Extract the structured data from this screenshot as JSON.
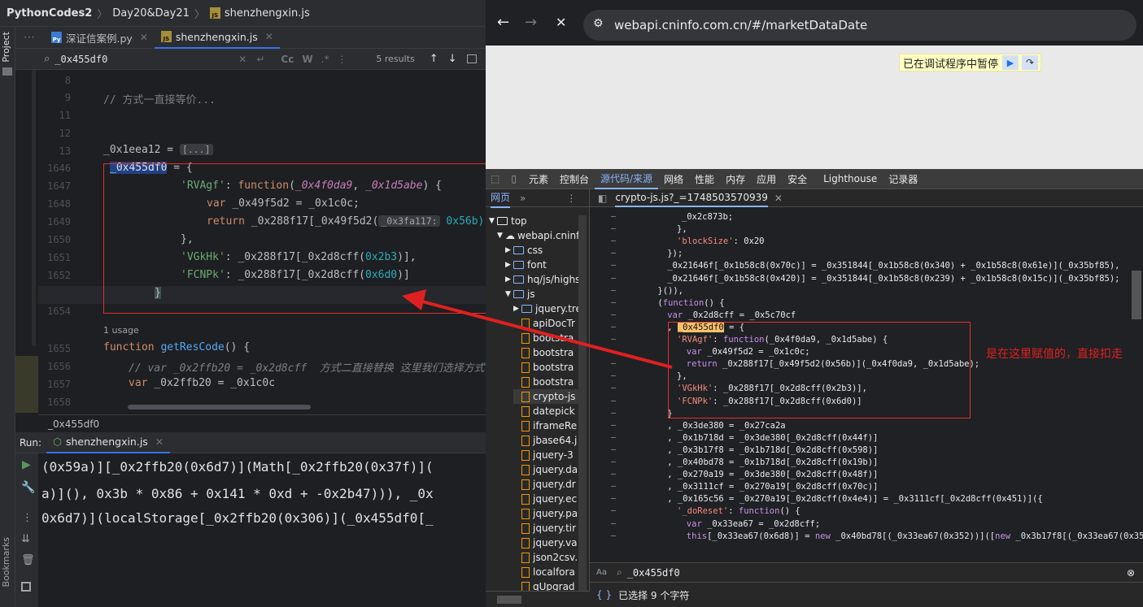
{
  "ide": {
    "breadcrumb": [
      "PythonCodes2",
      "Day20&Day21",
      "shenzhengxin.js"
    ],
    "side_tabs": {
      "project": "Project",
      "bookmarks": "Bookmarks"
    },
    "tabs": [
      {
        "label": "深证信案例.py",
        "active": false
      },
      {
        "label": "shenzhengxin.js",
        "active": true
      }
    ],
    "find": {
      "query": "_0x455df0",
      "results": "5 results",
      "cc": "Cc",
      "w": "W",
      "regex": ".*"
    },
    "lines": [
      {
        "n": "8"
      },
      {
        "n": "9"
      },
      {
        "n": "11"
      },
      {
        "n": "12"
      },
      {
        "n": "13"
      },
      {
        "n": "1646"
      },
      {
        "n": "1647"
      },
      {
        "n": "1648"
      },
      {
        "n": "1649"
      },
      {
        "n": "1650"
      },
      {
        "n": "1651"
      },
      {
        "n": "1652"
      },
      {
        "n": "1653"
      },
      {
        "n": "1654"
      },
      {
        "n": ""
      },
      {
        "n": "1655"
      },
      {
        "n": "1656"
      },
      {
        "n": "1657"
      },
      {
        "n": "1658"
      }
    ],
    "code": {
      "l9": "// 方式一直接等价...",
      "l13_var": "_0x1eea12",
      "l13_fold": "[...]",
      "l1646_var": "_0x455df0",
      "l1647_key": "'RVAgf'",
      "l1647_fn": "function",
      "l1647_p1": "_0x4f0da9",
      "l1647_p2": "_0x1d5abe",
      "l1648_kw": "var",
      "l1648_rest": "_0x49f5d2 = _0x1c0c;",
      "l1649_kw": "return",
      "l1649_rest": "_0x288f17[_0x49f5d2(",
      "l1649_hint": "_0x3fa117:",
      "l1649_num": "0x56b)",
      "l1651_key": "'VGkHk'",
      "l1651_rest": "_0x288f17[_0x2d8cff(",
      "l1651_num": "0x2b3",
      "l1652_key": "'FCNPk'",
      "l1652_rest": "_0x288f17[_0x2d8cff(",
      "l1652_num": "0x6d0",
      "usage": "1 usage",
      "l1655_kw": "function",
      "l1655_fn": "getResCode",
      "l1656_cmt": "// var _0x2ffb20 = _0x2d8cff  方式二直接替换 这里我们选择方式",
      "l1657_kw": "var",
      "l1657_rest": "_0x2ffb20 = _0x1c0c"
    },
    "status_var": "_0x455df0",
    "run": {
      "label": "Run:",
      "tab": "shenzhengxin.js"
    },
    "console": [
      "(0x59a)][_0x2ffb20(0x6d7)](Math[_0x2ffb20(0x37f)](",
      "a)](), 0x3b * 0x86 + 0x141 * 0xd + -0x2b47))), _0x",
      "0x6d7)](localStorage[_0x2ffb20(0x306)](_0x455df0[_"
    ]
  },
  "browser": {
    "url": "webapi.cninfo.com.cn/#/marketDataDate",
    "paused_text": "已在调试程序中暂停",
    "devtools": {
      "tabs": [
        "元素",
        "控制台",
        "源代码/来源",
        "网络",
        "性能",
        "内存",
        "应用",
        "安全",
        "Lighthouse",
        "记录器"
      ],
      "active_tab": "源代码/来源",
      "tree_tab": "网页",
      "file_tab": "crypto-js.js?_=1748503570939",
      "tree": [
        {
          "label": "top",
          "kind": "frame",
          "indent": 0
        },
        {
          "label": "webapi.cninfo",
          "kind": "cloud",
          "indent": 1
        },
        {
          "label": "css",
          "kind": "folder",
          "indent": 2
        },
        {
          "label": "font",
          "kind": "folder",
          "indent": 2
        },
        {
          "label": "hq/js/highs",
          "kind": "folder",
          "indent": 2
        },
        {
          "label": "js",
          "kind": "folder",
          "indent": 2
        },
        {
          "label": "jquery.tre",
          "kind": "folder",
          "indent": 3
        },
        {
          "label": "apiDocTr",
          "kind": "file",
          "indent": 3
        },
        {
          "label": "bootstra",
          "kind": "file",
          "indent": 3
        },
        {
          "label": "bootstra",
          "kind": "file",
          "indent": 3
        },
        {
          "label": "bootstra",
          "kind": "file",
          "indent": 3
        },
        {
          "label": "bootstra",
          "kind": "file",
          "indent": 3
        },
        {
          "label": "crypto-js",
          "kind": "file",
          "indent": 3
        },
        {
          "label": "datepick",
          "kind": "file",
          "indent": 3
        },
        {
          "label": "iframeRe",
          "kind": "file",
          "indent": 3
        },
        {
          "label": "jbase64.j",
          "kind": "file",
          "indent": 3
        },
        {
          "label": "jquery-3",
          "kind": "file",
          "indent": 3
        },
        {
          "label": "jquery.da",
          "kind": "file",
          "indent": 3
        },
        {
          "label": "jquery.dr",
          "kind": "file",
          "indent": 3
        },
        {
          "label": "jquery.ec",
          "kind": "file",
          "indent": 3
        },
        {
          "label": "jquery.pa",
          "kind": "file",
          "indent": 3
        },
        {
          "label": "jquery.tir",
          "kind": "file",
          "indent": 3
        },
        {
          "label": "jquery.va",
          "kind": "file",
          "indent": 3
        },
        {
          "label": "json2csv.",
          "kind": "file",
          "indent": 3
        },
        {
          "label": "localfora",
          "kind": "file",
          "indent": 3
        },
        {
          "label": "qUpgrad",
          "kind": "file",
          "indent": 3
        }
      ],
      "source": [
        {
          "t": "_0x2c873b;",
          "i": 11
        },
        {
          "t": "},",
          "i": 10
        },
        {
          "t": "'blockSize': 0x20",
          "i": 10
        },
        {
          "t": "});",
          "i": 8
        },
        {
          "t": "_0x21646f[_0x1b58c8(0x70c)] = _0x351844[_0x1b58c8(0x340) + _0x1b58c8(0x61e)](_0x35bf85),",
          "i": 8
        },
        {
          "t": "_0x21646f[_0x1b58c8(0x420)] = _0x351844[_0x1b58c8(0x239) + _0x1b58c8(0x15c)](_0x35bf85);",
          "i": 8
        },
        {
          "t": "}()),",
          "i": 6
        },
        {
          "t": "(function() {",
          "i": 6
        },
        {
          "t": "var _0x2d8cff = _0x5c70cf",
          "i": 8
        },
        {
          "t": ", _0x455df0 = {",
          "i": 8
        },
        {
          "t": "'RVAgf': function(_0x4f0da9, _0x1d5abe) {",
          "i": 10
        },
        {
          "t": "var _0x49f5d2 = _0x1c0c;",
          "i": 12
        },
        {
          "t": "return _0x288f17[_0x49f5d2(0x56b)](_0x4f0da9, _0x1d5abe);",
          "i": 12
        },
        {
          "t": "},",
          "i": 10
        },
        {
          "t": "'VGkHk': _0x288f17[_0x2d8cff(0x2b3)],",
          "i": 10
        },
        {
          "t": "'FCNPk': _0x288f17[_0x2d8cff(0x6d0)]",
          "i": 10
        },
        {
          "t": "}",
          "i": 8
        },
        {
          "t": ", _0x3de380 = _0x27ca2a",
          "i": 8
        },
        {
          "t": ", _0x1b718d = _0x3de380[_0x2d8cff(0x44f)]",
          "i": 8
        },
        {
          "t": ", _0x3b17f8 = _0x1b718d[_0x2d8cff(0x598)]",
          "i": 8
        },
        {
          "t": ", _0x40bd78 = _0x1b718d[_0x2d8cff(0x19b)]",
          "i": 8
        },
        {
          "t": ", _0x270a19 = _0x3de380[_0x2d8cff(0x48f)]",
          "i": 8
        },
        {
          "t": ", _0x3111cf = _0x270a19[_0x2d8cff(0x70c)]",
          "i": 8
        },
        {
          "t": ", _0x165c56 = _0x270a19[_0x2d8cff(0x4e4)] = _0x3111cf[_0x2d8cff(0x451)]({",
          "i": 8
        },
        {
          "t": "'_doReset': function() {",
          "i": 10
        },
        {
          "t": "var _0x33ea67 = _0x2d8cff;",
          "i": 12
        },
        {
          "t": "this[_0x33ea67(0x6d8)] = new _0x40bd78[(_0x33ea67(0x352))]([new _0x3b17f8[(_0x33ea67(0x352))](-0xa3",
          "i": 12
        }
      ],
      "search_value": "_0x455df0",
      "status_text": "已选择 9 个字符"
    },
    "annotation": "是在这里赋值的，直接扣走",
    "colors": {
      "annotation": "#e02020",
      "arrow": "#e02020"
    }
  }
}
